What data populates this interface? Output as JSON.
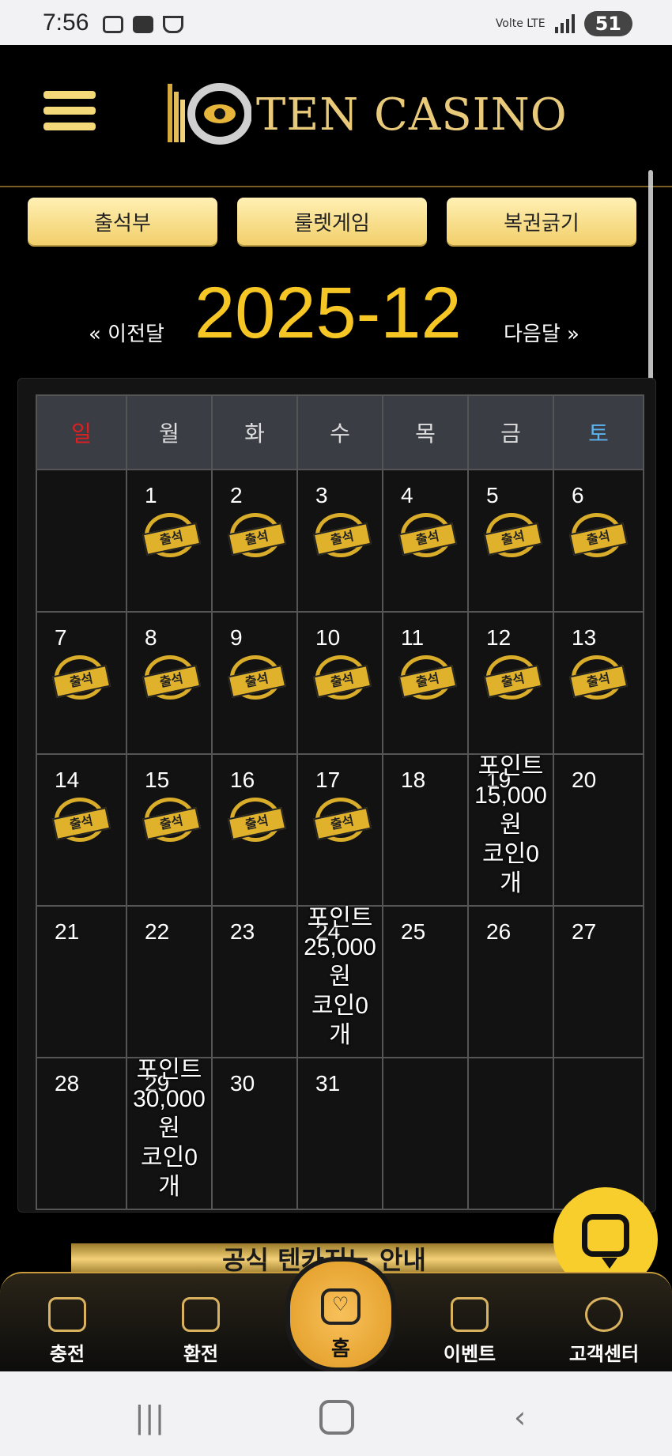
{
  "status_bar": {
    "time": "7:56",
    "network": "Volte LTE",
    "battery": "51"
  },
  "header": {
    "brand": "TEN CASINO"
  },
  "top_buttons": [
    "출석부",
    "룰렛게임",
    "복권긁기"
  ],
  "month_nav": {
    "prev": "« 이전달",
    "current": "2025-12",
    "next": "다음달 »"
  },
  "weekdays": [
    "일",
    "월",
    "화",
    "수",
    "목",
    "금",
    "토"
  ],
  "stamp_text": "출석",
  "weeks": [
    [
      {
        "d": ""
      },
      {
        "d": "1",
        "s": true
      },
      {
        "d": "2",
        "s": true
      },
      {
        "d": "3",
        "s": true
      },
      {
        "d": "4",
        "s": true
      },
      {
        "d": "5",
        "s": true
      },
      {
        "d": "6",
        "s": true
      }
    ],
    [
      {
        "d": "7",
        "s": true
      },
      {
        "d": "8",
        "s": true
      },
      {
        "d": "9",
        "s": true
      },
      {
        "d": "10",
        "s": true
      },
      {
        "d": "11",
        "s": true
      },
      {
        "d": "12",
        "s": true
      },
      {
        "d": "13",
        "s": true
      }
    ],
    [
      {
        "d": "14",
        "s": true
      },
      {
        "d": "15",
        "s": true
      },
      {
        "d": "16",
        "s": true
      },
      {
        "d": "17",
        "s": true
      },
      {
        "d": "18"
      },
      {
        "d": "19",
        "r": "포인트 15,000원 코인0개"
      },
      {
        "d": "20"
      }
    ],
    [
      {
        "d": "21"
      },
      {
        "d": "22"
      },
      {
        "d": "23"
      },
      {
        "d": "24",
        "r": "포인트 25,000원 코인0개"
      },
      {
        "d": "25"
      },
      {
        "d": "26"
      },
      {
        "d": "27"
      }
    ],
    [
      {
        "d": "28"
      },
      {
        "d": "29",
        "r": "포인트 30,000원 코인0개"
      },
      {
        "d": "30"
      },
      {
        "d": "31"
      },
      {
        "d": ""
      },
      {
        "d": ""
      },
      {
        "d": ""
      }
    ]
  ],
  "rewards": {
    "19": [
      "포인트",
      "15,000",
      "원",
      "코인0",
      "개"
    ],
    "24": [
      "포인트",
      "25,000",
      "원",
      "코인0",
      "개"
    ],
    "29": [
      "포인트",
      "30,000",
      "원",
      "코인0",
      "개"
    ]
  },
  "banner_text": "공식 텐카지노 안내",
  "bottom_nav": {
    "charge": "충전",
    "exchange": "환전",
    "home": "홈",
    "event": "이벤트",
    "support": "고객센터"
  },
  "colors": {
    "accent": "#f6c624",
    "sunday": "#e02020",
    "saturday": "#5bb4f0"
  }
}
